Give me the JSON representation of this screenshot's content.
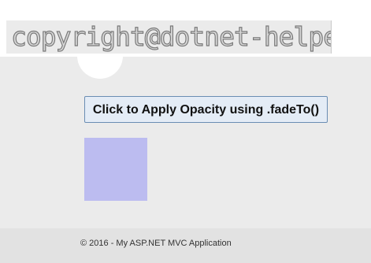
{
  "watermark": {
    "text": "copyright@dotnet-helpers.com"
  },
  "main": {
    "fade_button_label": "Click to Apply Opacity using .fadeTo()",
    "box_color": "#bcbcf0"
  },
  "footer": {
    "text": "© 2016 - My ASP.NET MVC Application"
  },
  "colors": {
    "page_background": "#ebebeb",
    "button_border": "#6a8db3",
    "button_background": "#e4ecf6"
  }
}
